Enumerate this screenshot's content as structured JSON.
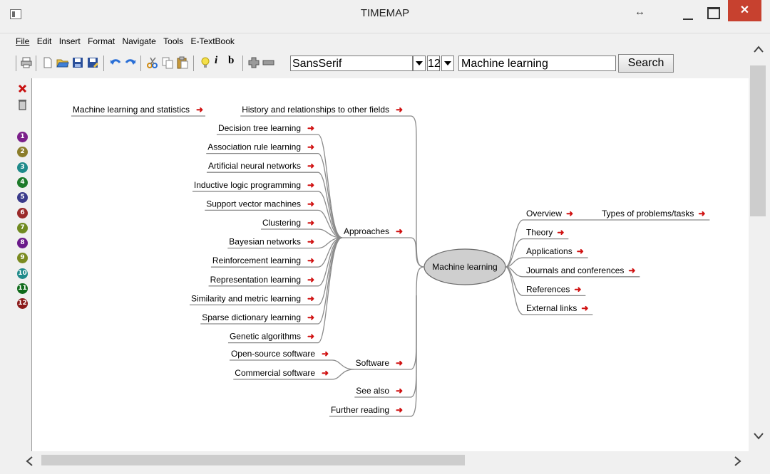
{
  "window": {
    "title": "TIMEMAP",
    "resize_glyph": "↔",
    "close_glyph": "✕"
  },
  "menu": [
    {
      "label": "File",
      "underlined": true
    },
    {
      "label": "Edit"
    },
    {
      "label": "Insert"
    },
    {
      "label": "Format"
    },
    {
      "label": "Navigate"
    },
    {
      "label": "Tools"
    },
    {
      "label": "E-TextBook"
    }
  ],
  "toolbar": {
    "font_family": "SansSerif",
    "font_size": "12",
    "search_value": "Machine learning",
    "search_button": "Search",
    "italic_label": "i",
    "bold_label": "b",
    "icons": [
      "print-icon",
      "new-document-icon",
      "open-folder-icon",
      "save-icon",
      "save-as-icon",
      "undo-icon",
      "redo-icon",
      "cut-icon",
      "copy-icon",
      "paste-icon",
      "lightbulb-icon",
      "italic-icon",
      "bold-icon",
      "zoom-in-icon",
      "zoom-out-icon"
    ]
  },
  "left_strip": {
    "tools": [
      "delete-icon",
      "trash-icon"
    ],
    "markers": [
      {
        "label": "1",
        "color": "#7b1f8a"
      },
      {
        "label": "2",
        "color": "#8b7d2a"
      },
      {
        "label": "3",
        "color": "#1f8a8a"
      },
      {
        "label": "4",
        "color": "#1d7a2a"
      },
      {
        "label": "5",
        "color": "#3a3a8a"
      },
      {
        "label": "6",
        "color": "#9a2a2a"
      },
      {
        "label": "7",
        "color": "#6f8a20"
      },
      {
        "label": "8",
        "color": "#6a1a8a"
      },
      {
        "label": "9",
        "color": "#7a8a20"
      },
      {
        "label": "10",
        "color": "#1f8a8a"
      },
      {
        "label": "11",
        "color": "#0f6a1a"
      },
      {
        "label": "12",
        "color": "#8a1a1a"
      }
    ]
  },
  "mindmap": {
    "center": "Machine learning",
    "arrow_color": "#d01010",
    "left_branches": [
      {
        "label": "History and relationships to other fields",
        "children": [
          {
            "label": "Machine learning and statistics"
          }
        ]
      },
      {
        "label": "Approaches",
        "children": [
          {
            "label": "Decision tree learning"
          },
          {
            "label": "Association rule learning"
          },
          {
            "label": "Artificial neural networks"
          },
          {
            "label": "Inductive logic programming"
          },
          {
            "label": "Support vector machines"
          },
          {
            "label": "Clustering"
          },
          {
            "label": "Bayesian networks"
          },
          {
            "label": "Reinforcement learning"
          },
          {
            "label": "Representation learning"
          },
          {
            "label": "Similarity and metric learning"
          },
          {
            "label": "Sparse dictionary learning"
          },
          {
            "label": "Genetic algorithms"
          }
        ]
      },
      {
        "label": "Software",
        "children": [
          {
            "label": "Open-source software"
          },
          {
            "label": "Commercial software"
          }
        ]
      },
      {
        "label": "See also"
      },
      {
        "label": "Further reading"
      }
    ],
    "right_branches": [
      {
        "label": "Overview",
        "children": [
          {
            "label": "Types of problems/tasks"
          }
        ]
      },
      {
        "label": "Theory"
      },
      {
        "label": "Applications"
      },
      {
        "label": "Journals and conferences"
      },
      {
        "label": "References"
      },
      {
        "label": "External links"
      }
    ]
  }
}
